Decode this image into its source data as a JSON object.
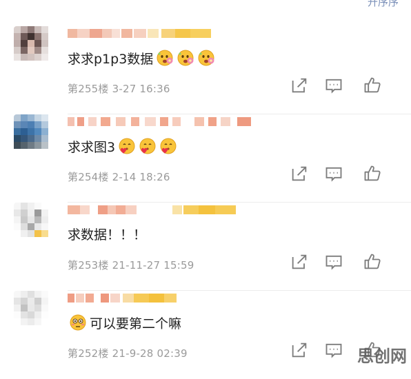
{
  "header": {
    "sort_label": "升序序"
  },
  "comments": [
    {
      "text": "求求p1p3数据",
      "emoji_count": 3,
      "emoji_kind": "flower",
      "meta": "第255楼 3-27 16:36"
    },
    {
      "text": "求求图3",
      "emoji_count": 3,
      "emoji_kind": "heart",
      "meta": "第254楼 2-14 18:26"
    },
    {
      "text": "求数据！！！",
      "emoji_count": 0,
      "emoji_kind": "",
      "meta": "第253楼 21-11-27 15:59"
    },
    {
      "text": "可以要第二个嘛",
      "emoji_count": 1,
      "emoji_kind": "flushed",
      "meta": "第252楼 21-9-28 02:39"
    }
  ],
  "icons": [
    "share-icon",
    "reply-icon",
    "like-icon"
  ],
  "watermark": "思创网",
  "colors": {
    "meta": "#9a9a9a",
    "icon": "#7d7d7d",
    "sort": "#7a8fb8"
  }
}
